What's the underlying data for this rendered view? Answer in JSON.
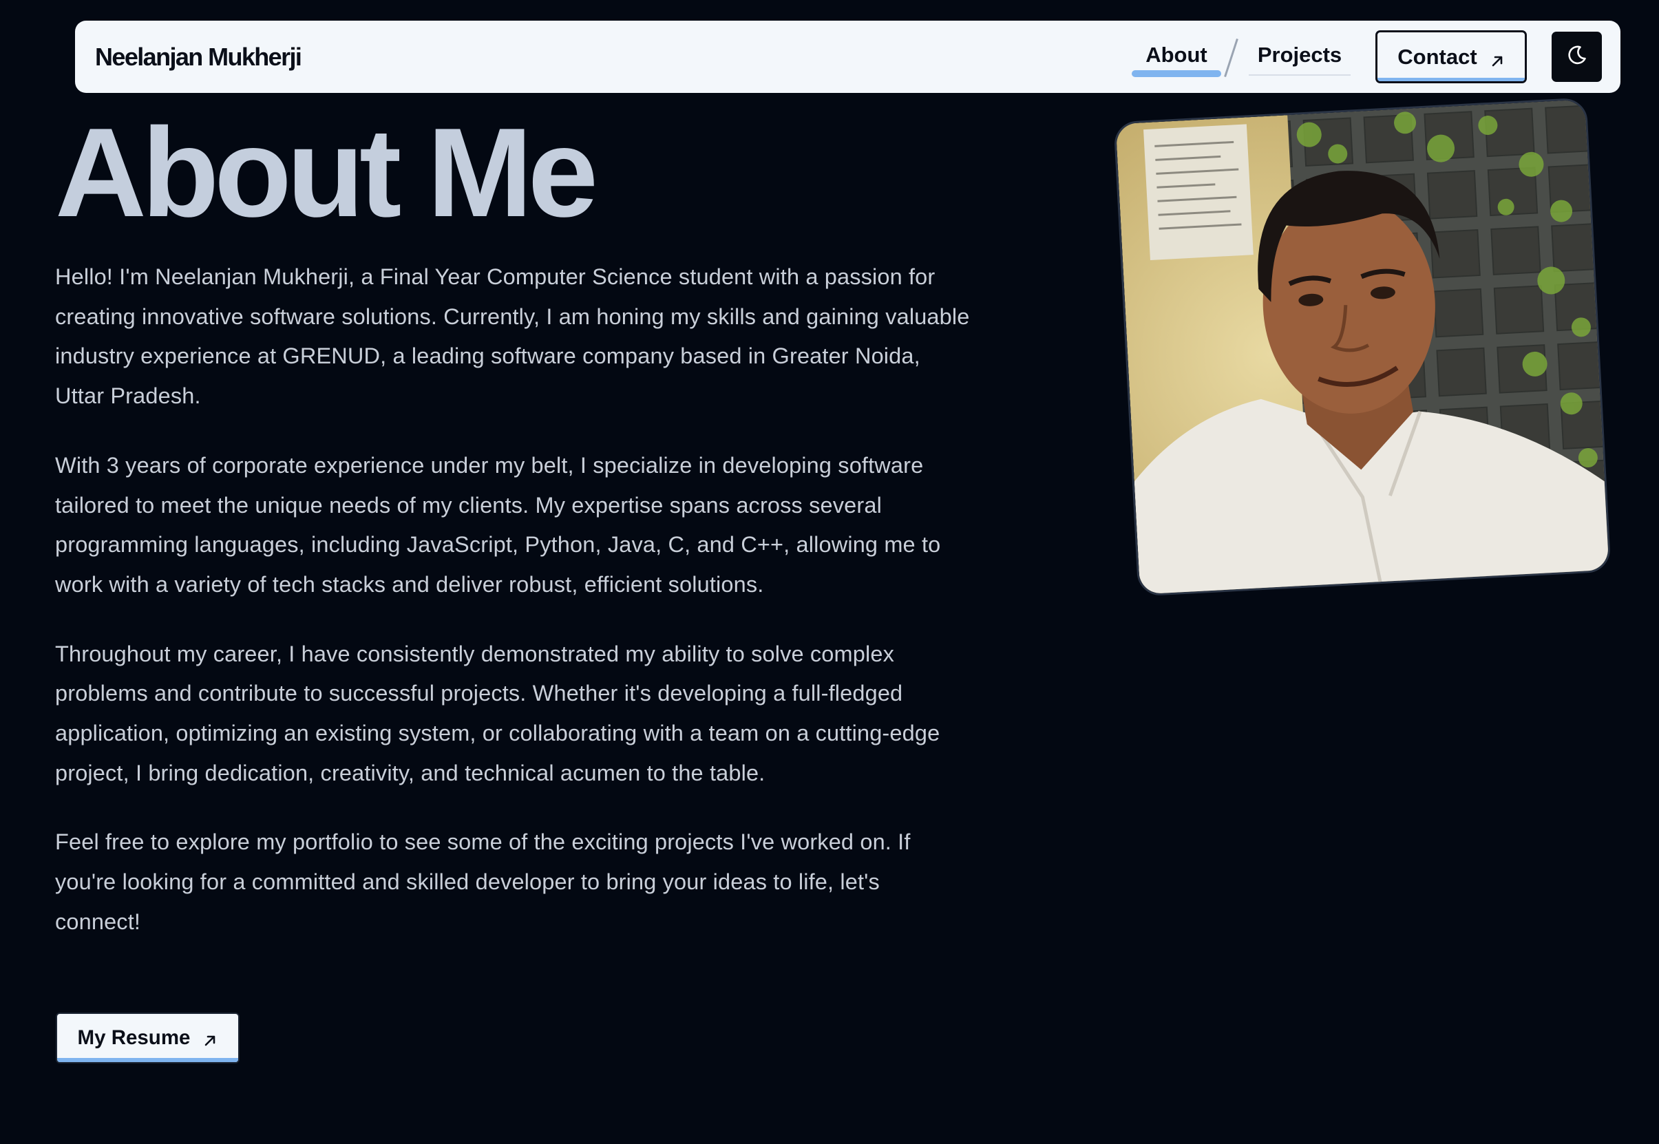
{
  "header": {
    "brand": "Neelanjan Mukherji",
    "nav": {
      "about": "About",
      "projects": "Projects"
    },
    "contact_label": "Contact",
    "contact_icon": "arrow-up-right-icon",
    "theme_toggle_icon": "moon-icon"
  },
  "main": {
    "title": "About Me",
    "paragraphs": [
      "Hello! I'm Neelanjan Mukherji, a Final Year Computer Science student with a passion for creating innovative software solutions. Currently, I am honing my skills and gaining valuable industry experience at GRENUD, a leading software company based in Greater Noida, Uttar Pradesh.",
      "With 3 years of corporate experience under my belt, I specialize in developing software tailored to meet the unique needs of my clients. My expertise spans across several programming languages, including JavaScript, Python, Java, C, and C++, allowing me to work with a variety of tech stacks and deliver robust, efficient solutions.",
      "Throughout my career, I have consistently demonstrated my ability to solve complex problems and contribute to successful projects. Whether it's developing a full-fledged application, optimizing an existing system, or collaborating with a team on a cutting-edge project, I bring dedication, creativity, and technical acumen to the table.",
      "Feel free to explore my portfolio to see some of the exciting projects I've worked on. If you're looking for a committed and skilled developer to bring your ideas to life, let's connect!"
    ],
    "resume_label": "My Resume",
    "resume_icon": "arrow-up-right-icon"
  },
  "colors": {
    "background": "#030812",
    "nav_background": "#f3f7fb",
    "accent": "#7fb4ef",
    "title": "#c4cedd",
    "body_text": "#c9cfd9"
  }
}
